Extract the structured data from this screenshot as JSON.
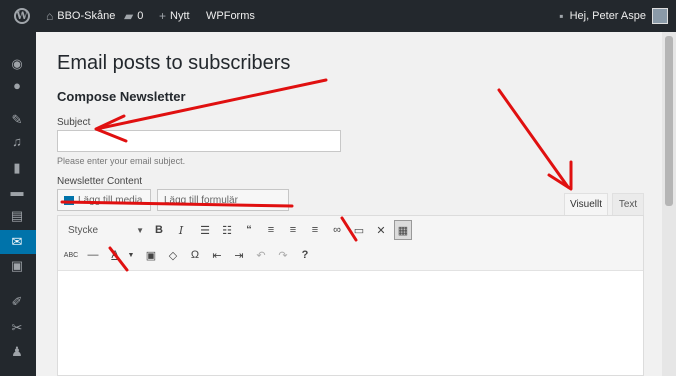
{
  "adminbar": {
    "site_name": "BBO-Skåne",
    "comments_count": "0",
    "new_label": "Nytt",
    "wpforms_label": "WPForms",
    "greeting": "Hej, Peter Aspe"
  },
  "main": {
    "page_title": "Email posts to subscribers",
    "section_title": "Compose Newsletter",
    "subject_label": "Subject",
    "subject_value": "",
    "subject_help": "Please enter your email subject.",
    "content_label": "Newsletter Content",
    "add_media_label": "Lägg till media",
    "add_form_label": "Lägg till formulär"
  },
  "editor": {
    "tab_visual": "Visuellt",
    "tab_text": "Text",
    "format_select": "Stycke"
  },
  "colors": {
    "adminbar_bg": "#23282d",
    "accent": "#0073aa",
    "annotation": "#e01010"
  }
}
